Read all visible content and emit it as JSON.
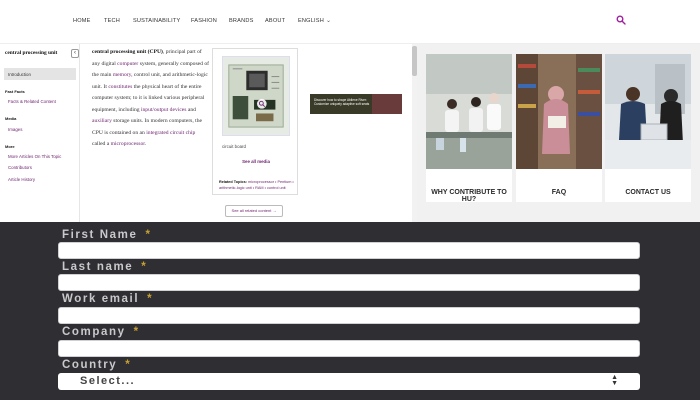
{
  "nav": {
    "items": [
      "HOME",
      "TECH",
      "SUSTAINABILITY",
      "FASHION",
      "BRANDS",
      "ABOUT",
      "ENGLISH"
    ]
  },
  "article": {
    "sidebar": {
      "title": "central processing unit",
      "active": "Introduction",
      "fact_head": "Fast Facts",
      "fact_link": "Facts & Related Content",
      "media_head": "Media",
      "media_link": "Images",
      "more_head": "More",
      "more_links": [
        "More Articles On This Topic",
        "Contributors",
        "Article History"
      ]
    },
    "body": {
      "t1": "central processing unit (CPU)",
      "t2": ", principal part of any digital ",
      "l1": "computer",
      "t3": " system, generally composed of the main ",
      "l2": "memory",
      "t4": ", control unit, and arithmetic-logic unit. It ",
      "l3": "constitutes",
      "t5": " the physical heart of the entire computer system; to it is linked various peripheral equipment, including ",
      "l4": "input/output devices",
      "t6": " and ",
      "l5": "auxiliary",
      "t7": " storage units. In modern computers, the CPU is contained on an ",
      "l6": "integrated circuit chip",
      "t8": " called a ",
      "l7": "microprocessor",
      "t9": "."
    },
    "media": {
      "caption": "circuit board",
      "see_all": "See all media",
      "related_label": "Related Topics:",
      "related_text": " microprocessor • Pentium • arithmetic-logic unit • RAM • control unit"
    },
    "see_all_related": "See all related content →",
    "ad_text": "Discover how to shape Abilene River: Customize uniquely adaptive soft seats"
  },
  "cards": [
    {
      "label": "WHY CONTRIBUTE TO HU?"
    },
    {
      "label": "FAQ"
    },
    {
      "label": "CONTACT US"
    }
  ],
  "form": {
    "fields": [
      {
        "label": "First Name",
        "req": "*",
        "value": ""
      },
      {
        "label": "Last name",
        "req": "*",
        "value": ""
      },
      {
        "label": "Work email",
        "req": "*",
        "value": ""
      },
      {
        "label": "Company",
        "req": "*",
        "value": ""
      }
    ],
    "country": {
      "label": "Country",
      "req": "*",
      "selected": "Select..."
    }
  },
  "colors": {
    "accent": "#a020a0",
    "link": "#6b1e6b",
    "form_bg": "#2f2f33",
    "required": "#c8a032"
  },
  "icons": [
    "search-icon",
    "chevron-down-icon",
    "collapse-icon",
    "zoom-icon",
    "select-arrows-icon"
  ]
}
